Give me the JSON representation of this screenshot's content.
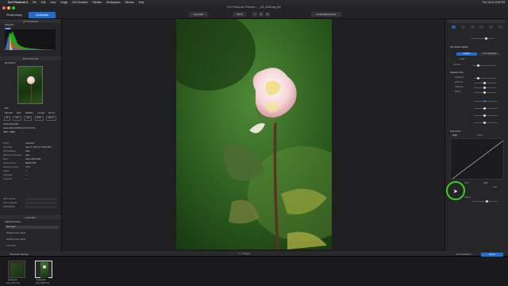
{
  "menubar": {
    "app": "DxO PhotoLab 6",
    "items": [
      "File",
      "Edit",
      "View",
      "Image",
      "DxO Modules",
      "Palettes",
      "Workspaces",
      "Window",
      "Help"
    ],
    "clock": "Tue Oct 11  8:29 PM"
  },
  "toolbar": {
    "title": "DxO PhotoLab 6 Review — _MG_9648.dng (M)",
    "tab_photolibrary": "PhotoLibrary",
    "tab_customize": "Customize",
    "compare": "Compare",
    "zoom": "48 %",
    "local_adjustments": "Local Adjustments"
  },
  "left": {
    "histogram_header": "HISTOGRAM",
    "histogram_label": "Histogram",
    "histogram_button": "RGB",
    "moveZoom_header": "MOVE/ZOOM",
    "moveZoom_label": "Move/Zoom",
    "exif_label": "Exif",
    "exif_iso": "ISO 100",
    "exif_aperture": "f/2.8",
    "exif_shutter": "1/2000 s",
    "exif_ev": "+1.0 EV",
    "exif_focal": "90 mm",
    "exif_row2": [
      "M",
      "ISO",
      "100",
      "f/8.0",
      "90mm"
    ],
    "camera": "Canon EOS 40D",
    "lens": "Canon EF-S 18-55 mm f/3.5-5.6 IS",
    "dims": "2592 × 3888",
    "metadata": [
      {
        "k": "Rating",
        "v": "★★★★★"
      },
      {
        "k": "Shot Date",
        "v": "Aug 17, 2017 at 7:36:40 PM"
      },
      {
        "k": "White Balance",
        "v": "Auto"
      },
      {
        "k": "Flash Compensation",
        "v": "Auto"
      },
      {
        "k": "Body",
        "v": "Canon EOS 40D"
      },
      {
        "k": "Serial Number",
        "v": "802917 857"
      },
      {
        "k": "Software Version",
        "v": "1.0.3"
      },
      {
        "k": "Author",
        "v": "—"
      },
      {
        "k": "Copyright",
        "v": "—"
      },
      {
        "k": "Keywords",
        "v": "—"
      }
    ],
    "gps": [
      {
        "k": "GPS Latitude",
        "v": ""
      },
      {
        "k": "GPS Longitude",
        "v": ""
      },
      {
        "k": "GPS Altitude",
        "v": ""
      }
    ],
    "history_header": "HISTORY",
    "history_label": "Advanced History",
    "history_items": [
      "First Sync",
      "Working Color Space",
      "Working Color Space",
      "Crop area"
    ]
  },
  "right": {
    "search_placeholder": "Search for corrections",
    "smart_lighting": "DxO Smart Lighting",
    "uniform": "Uniform",
    "spot_weighted": "Spot Weighted",
    "slight": "Slight",
    "mode_label": "Intensity",
    "selective_tone": "Selective Tone",
    "highlights": "Highlights",
    "midtones": "Midtones",
    "shadows": "Shadows",
    "blacks": "Blacks",
    "tone_curve": "Tone Curve",
    "channel": "RGB",
    "preset": "Preset",
    "curve_gamma": "1.00",
    "curve_auto": "Auto",
    "curve_out_label": "Output",
    "curve_in_label": "Input"
  },
  "film": {
    "count": "1 / 2 images",
    "folder": "PhotoLab 6 Review",
    "thumbs": [
      {
        "name": "First_Z-57.dng",
        "stars": "★★★★★"
      },
      {
        "name": "_MG_9648.dng",
        "stars": "★★★★★"
      }
    ],
    "dxo_collection": "DxO Collection",
    "export": "Export"
  },
  "colors": {
    "accent": "#1f6fd1",
    "cursor_ring": "#39d11f"
  }
}
